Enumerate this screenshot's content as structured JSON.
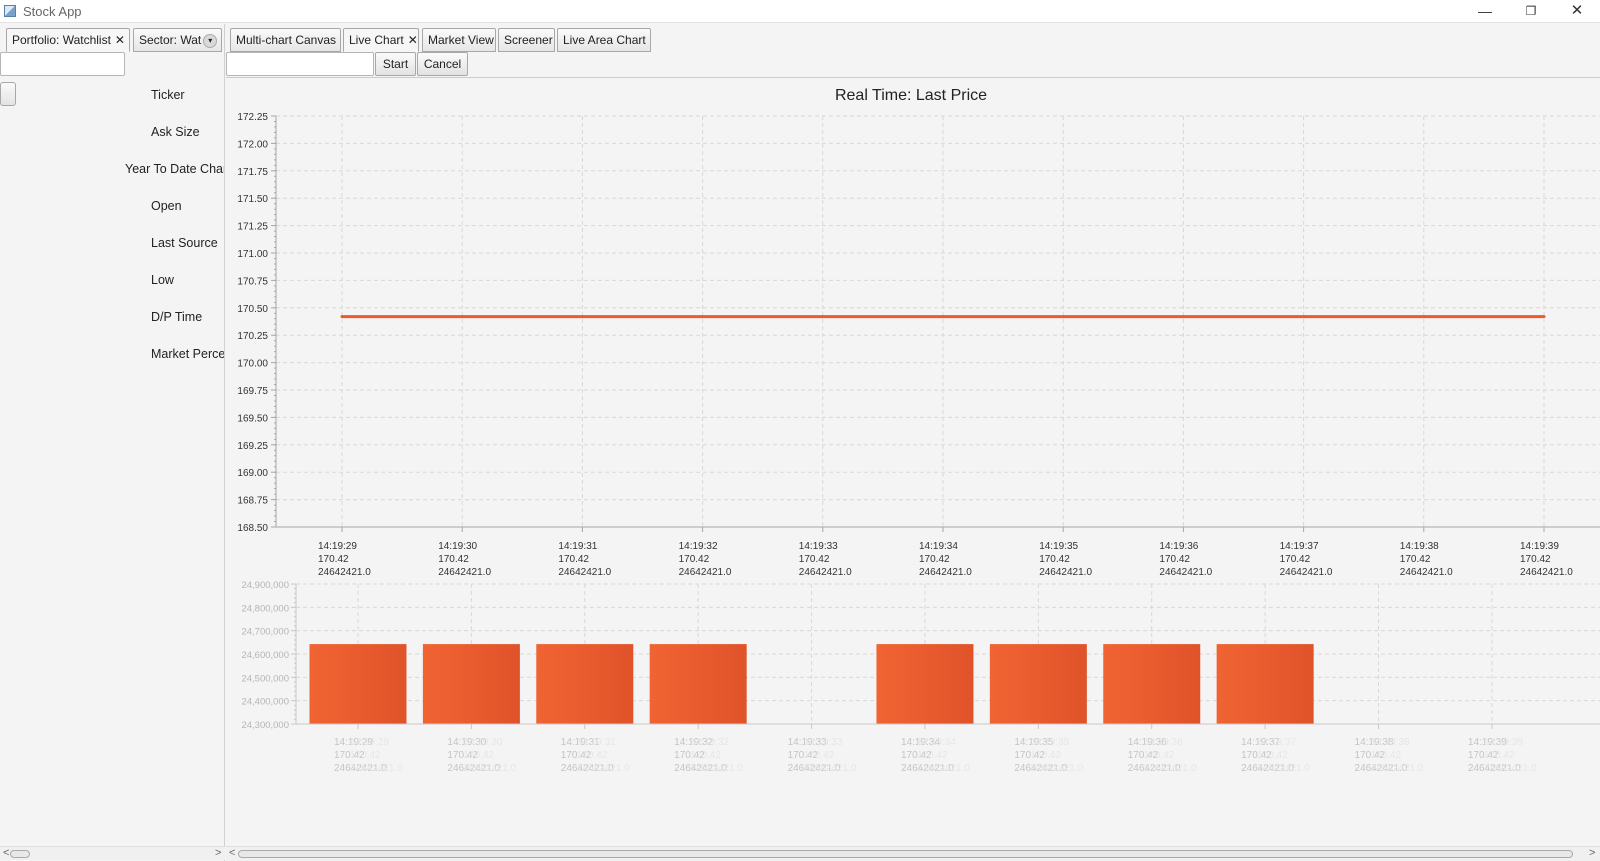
{
  "window": {
    "title": "Stock App",
    "controls": {
      "minimize": "—",
      "maximize": "❐",
      "close": "✕"
    }
  },
  "left_tabs": [
    {
      "label": "Portfolio: Watchlist",
      "closable": true,
      "close_glyph": "✕"
    },
    {
      "label": "Sector: Wat",
      "dropdown_glyph": "▾"
    }
  ],
  "left_panel": {
    "search_value": "",
    "fields": [
      "Ticker",
      "Ask Size",
      "Year To Date Chang",
      "Open",
      "Last Source",
      "Low",
      "D/P Time",
      "Market Percen"
    ]
  },
  "right_tabs": [
    {
      "label": "Multi-chart Canvas"
    },
    {
      "label": "Live Chart",
      "closable": true,
      "close_glyph": "✕",
      "selected": true
    },
    {
      "label": "Market View"
    },
    {
      "label": "Screener"
    },
    {
      "label": "Live Area Chart"
    }
  ],
  "toolbar": {
    "input_value": "",
    "start_label": "Start",
    "cancel_label": "Cancel"
  },
  "scrollbar_arrows": {
    "left": "<",
    "right": ">"
  },
  "colors": {
    "series": "#ee5a2b",
    "bar_light": "#f06433",
    "bar_dark": "#e0532a",
    "grid": "#d8d8d8",
    "axis": "#a6a6a6"
  },
  "chart_data": [
    {
      "type": "line",
      "title": "Real Time: Last Price",
      "x": [
        [
          "14:19:29",
          "170.42",
          "24642421.0"
        ],
        [
          "14:19:30",
          "170.42",
          "24642421.0"
        ],
        [
          "14:19:31",
          "170.42",
          "24642421.0"
        ],
        [
          "14:19:32",
          "170.42",
          "24642421.0"
        ],
        [
          "14:19:33",
          "170.42",
          "24642421.0"
        ],
        [
          "14:19:34",
          "170.42",
          "24642421.0"
        ],
        [
          "14:19:35",
          "170.42",
          "24642421.0"
        ],
        [
          "14:19:36",
          "170.42",
          "24642421.0"
        ],
        [
          "14:19:37",
          "170.42",
          "24642421.0"
        ],
        [
          "14:19:38",
          "170.42",
          "24642421.0"
        ],
        [
          "14:19:39",
          "170.42",
          "24642421.0"
        ]
      ],
      "values": [
        170.42,
        170.42,
        170.42,
        170.42,
        170.42,
        170.42,
        170.42,
        170.42,
        170.42,
        170.42,
        170.42
      ],
      "ylim": [
        168.5,
        172.25
      ],
      "yticks": [
        "168.50",
        "168.75",
        "169.00",
        "169.25",
        "169.50",
        "169.75",
        "170.00",
        "170.25",
        "170.50",
        "170.75",
        "171.00",
        "171.25",
        "171.50",
        "171.75",
        "172.00",
        "172.25"
      ],
      "grid": true
    },
    {
      "type": "bar",
      "title": "",
      "categories": [
        [
          "14:19:29",
          "170.42",
          "24642421.0"
        ],
        [
          "14:19:30",
          "170.42",
          "24642421.0"
        ],
        [
          "14:19:31",
          "170.42",
          "24642421.0"
        ],
        [
          "14:19:32",
          "170.42",
          "24642421.0"
        ],
        [
          "14:19:33",
          "170.42",
          "24642421.0"
        ],
        [
          "14:19:34",
          "170.42",
          "24642421.0"
        ],
        [
          "14:19:35",
          "170.42",
          "24642421.0"
        ],
        [
          "14:19:36",
          "170.42",
          "24642421.0"
        ],
        [
          "14:19:37",
          "170.42",
          "24642421.0"
        ],
        [
          "14:19:38",
          "170.42",
          "24642421.0"
        ],
        [
          "14:19:39",
          "170.42",
          "24642421.0"
        ]
      ],
      "values": [
        24642421,
        24642421,
        24642421,
        24642421,
        null,
        24642421,
        24642421,
        24642421,
        24642421,
        null,
        null
      ],
      "ylim": [
        24300000,
        24900000
      ],
      "yticks": [
        "24,300,000",
        "24,400,000",
        "24,500,000",
        "24,600,000",
        "24,700,000",
        "24,800,000",
        "24,900,000"
      ],
      "grid": true
    }
  ]
}
